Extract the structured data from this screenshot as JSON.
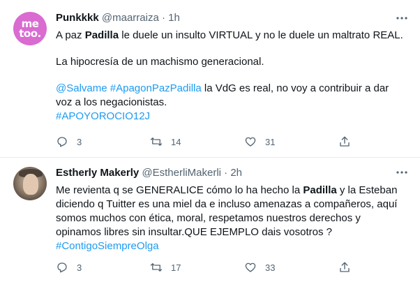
{
  "tweets": [
    {
      "name": "Punkkkk",
      "handle": "@maarraiza",
      "sep": "·",
      "time": "1h",
      "avatar_text": [
        "me",
        "too."
      ],
      "text": {
        "l1_pre": "A paz ",
        "l1_bold": "Padilla",
        "l1_post": " le duele un insulto VIRTUAL y no le duele un maltrato REAL.",
        "l2": "La hipocresía de un machismo generacional.",
        "l3_link1": "@Salvame",
        "l3_link2": "#ApagonPazPadilla",
        "l3_post": " la VdG es real, no voy a contribuir a dar",
        "l4": "voz a los negacionistas.",
        "l5_link": "#APOYOROCIO12J"
      },
      "replies": "3",
      "retweets": "14",
      "likes": "31"
    },
    {
      "name": "Estherly Makerly",
      "handle": "@EstherliMakerli",
      "sep": "·",
      "time": "2h",
      "text": {
        "l1_pre": "Me revienta q se GENERALICE cómo lo ha hecho la ",
        "l1_bold": "Padilla",
        "l1_post": " y la Esteban",
        "l2": "diciendo q Tuitter es una miel da e incluso amenazas a compañeros, aquí",
        "l3": "somos muchos con ética, moral, respetamos nuestros derechos y",
        "l4": "opinamos libres sin insultar.QUE EJEMPLO dais vosotros ?",
        "l5_link": "#ContigoSiempreOlga"
      },
      "replies": "3",
      "retweets": "17",
      "likes": "33"
    }
  ],
  "icons": {
    "more": "more-horizontal-icon",
    "reply": "reply-icon",
    "retweet": "retweet-icon",
    "like": "heart-icon",
    "share": "share-icon"
  },
  "colors": {
    "link": "#1d9bf0",
    "secondary": "#536471",
    "divider": "#e6ecf0",
    "metoo_avatar": "#d96bd1"
  }
}
